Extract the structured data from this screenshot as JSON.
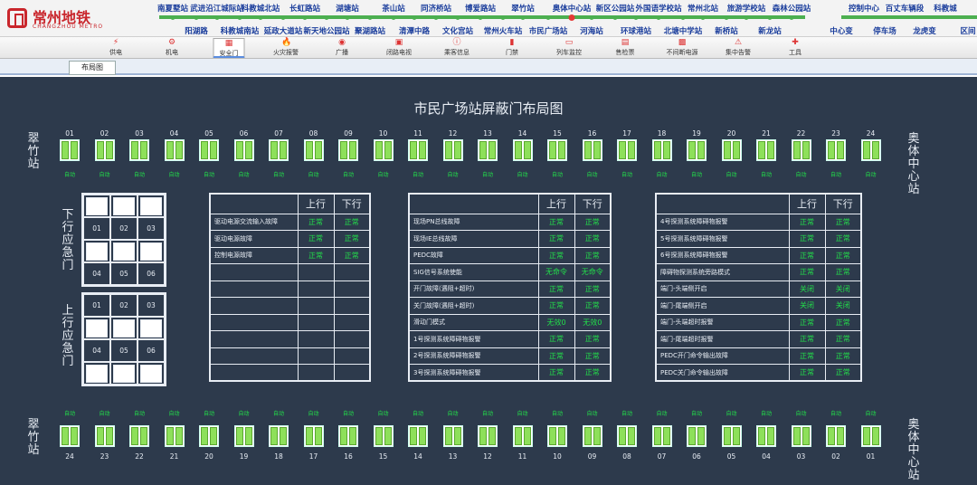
{
  "brand": {
    "name": "常州地铁",
    "sub": "CHANGZHOU METRO"
  },
  "stations_top": [
    "南夏墅站",
    "武进沿江城际站",
    "科教城北站",
    "长虹路站",
    "湖塘站",
    "茶山站",
    "同济桥站",
    "博爱路站",
    "翠竹站",
    "奥体中心站",
    "新区公园站",
    "外国语学校站",
    "常州北站",
    "旅游学校站",
    "森林公园站"
  ],
  "stations_bottom": [
    "阳湖路",
    "科教城南站",
    "延政大道站",
    "新天地公园站",
    "聚湖路站",
    "清潭中路",
    "文化宫站",
    "常州火车站",
    "市民广场站",
    "河海站",
    "环球港站",
    "北塘中学站",
    "新桥站",
    "新龙站"
  ],
  "stations_right_top": [
    "控制中心",
    "百丈车辆段",
    "科教城"
  ],
  "stations_right_bottom": [
    "中心变",
    "停车场",
    "龙虎变",
    "区间"
  ],
  "current_station": "奥体中心站",
  "toolbar": [
    "供电",
    "机电",
    "安全门",
    "火灾报警",
    "广播",
    "闭路电视",
    "乘客信息",
    "门禁",
    "列车监控",
    "售检票",
    "不间断电源",
    "集中告警",
    "工具"
  ],
  "active_tool": "安全门",
  "tab": "布局图",
  "title": "市民广场站屏蔽门布局图",
  "left_station": "翠竹站",
  "right_station": "奥体中心站",
  "top_doors": [
    "01",
    "02",
    "03",
    "04",
    "05",
    "06",
    "07",
    "08",
    "09",
    "10",
    "11",
    "12",
    "13",
    "14",
    "15",
    "16",
    "17",
    "18",
    "19",
    "20",
    "21",
    "22",
    "23",
    "24"
  ],
  "bottom_doors": [
    "24",
    "23",
    "22",
    "21",
    "20",
    "19",
    "18",
    "17",
    "16",
    "15",
    "14",
    "13",
    "12",
    "11",
    "10",
    "09",
    "08",
    "07",
    "06",
    "05",
    "04",
    "03",
    "02",
    "01"
  ],
  "door_status": "自动",
  "emergency_down": {
    "label": "下行应急门",
    "nums": [
      "01",
      "02",
      "03",
      "04",
      "05",
      "06"
    ]
  },
  "emergency_up": {
    "label": "上行应急门",
    "nums": [
      "01",
      "02",
      "03",
      "04",
      "05",
      "06"
    ]
  },
  "col_up": "上行",
  "col_down": "下行",
  "table1": [
    [
      "驱动电源交流输入故障",
      "正常",
      "正常"
    ],
    [
      "驱动电源故障",
      "正常",
      "正常"
    ],
    [
      "控制电源故障",
      "正常",
      "正常"
    ],
    [
      "",
      "",
      ""
    ],
    [
      "",
      "",
      ""
    ],
    [
      "",
      "",
      ""
    ],
    [
      "",
      "",
      ""
    ],
    [
      "",
      "",
      ""
    ],
    [
      "",
      "",
      ""
    ],
    [
      "",
      "",
      ""
    ]
  ],
  "table2": [
    [
      "现场PN总线故障",
      "正常",
      "正常"
    ],
    [
      "现场IE总线故障",
      "正常",
      "正常"
    ],
    [
      "PEDC故障",
      "正常",
      "正常"
    ],
    [
      "SIG信号系统使能",
      "无命令",
      "无命令"
    ],
    [
      "开门故障(遇阻+超时)",
      "正常",
      "正常"
    ],
    [
      "关门故障(遇阻+超时)",
      "正常",
      "正常"
    ],
    [
      "滑动门模式",
      "无效0",
      "无效0"
    ],
    [
      "1号探测系统障碍物报警",
      "正常",
      "正常"
    ],
    [
      "2号探测系统障碍物报警",
      "正常",
      "正常"
    ],
    [
      "3号探测系统障碍物报警",
      "正常",
      "正常"
    ]
  ],
  "table3": [
    [
      "4号探测系统障碍物报警",
      "正常",
      "正常"
    ],
    [
      "5号探测系统障碍物报警",
      "正常",
      "正常"
    ],
    [
      "6号探测系统障碍物报警",
      "正常",
      "正常"
    ],
    [
      "障碍物探测系统旁路模式",
      "正常",
      "正常"
    ],
    [
      "端门-头端侧开启",
      "关闭",
      "关闭"
    ],
    [
      "端门-尾端侧开启",
      "关闭",
      "关闭"
    ],
    [
      "端门-头端超时报警",
      "正常",
      "正常"
    ],
    [
      "端门-尾端超时报警",
      "正常",
      "正常"
    ],
    [
      "PEDC开门命令输出故障",
      "正常",
      "正常"
    ],
    [
      "PEDC关门命令输出故障",
      "正常",
      "正常"
    ]
  ]
}
